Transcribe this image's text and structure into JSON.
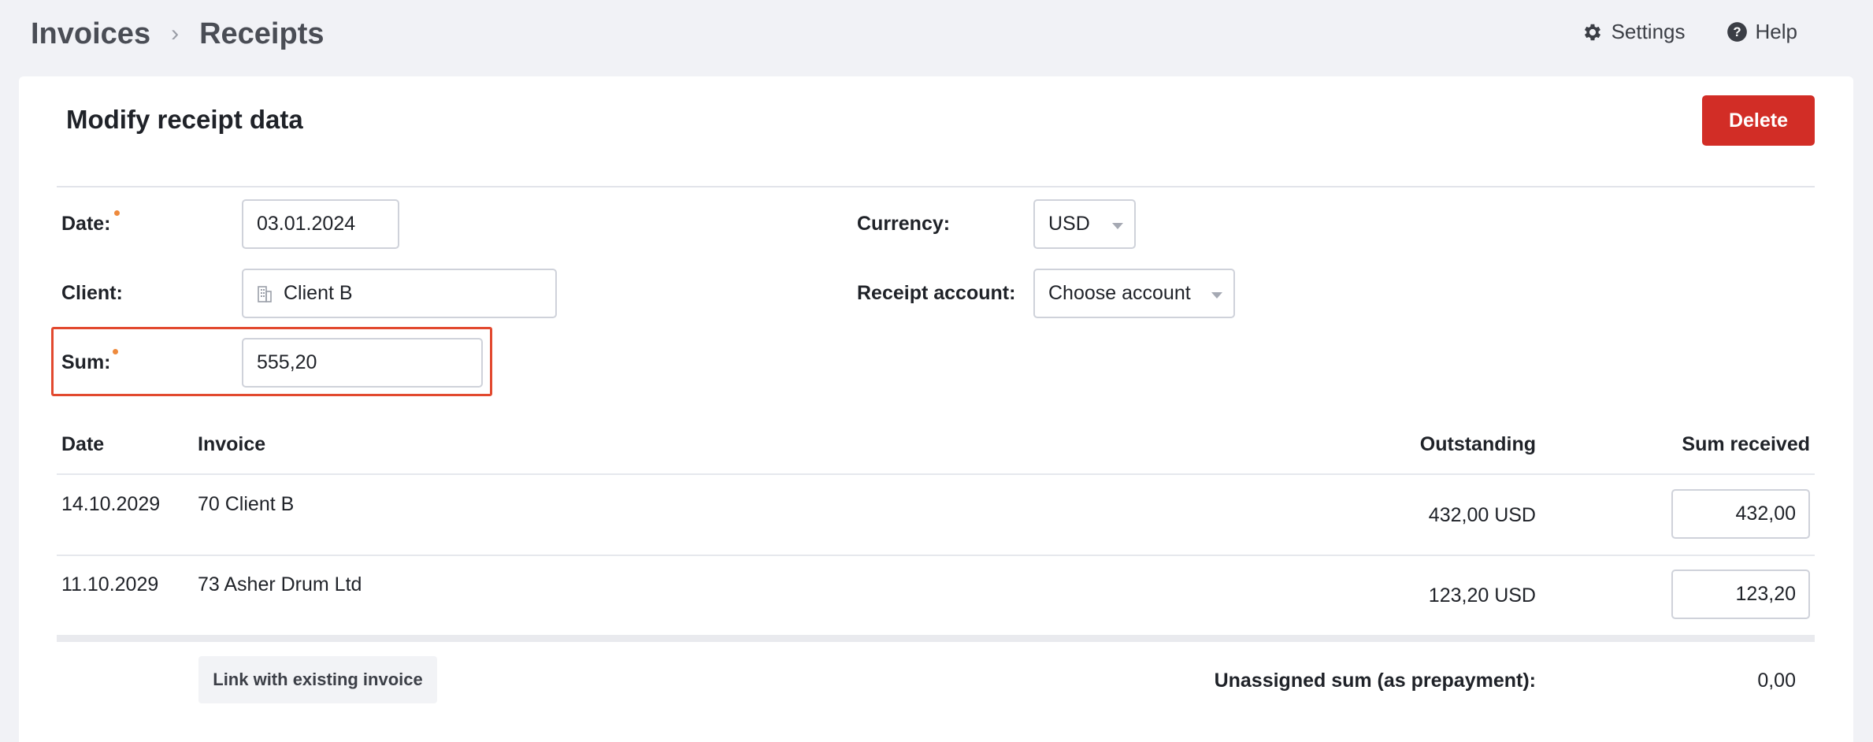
{
  "breadcrumb": {
    "parent": "Invoices",
    "separator": "›",
    "current": "Receipts"
  },
  "top_actions": {
    "settings_label": "Settings",
    "help_label": "Help"
  },
  "page": {
    "title": "Modify receipt data",
    "delete_label": "Delete"
  },
  "form": {
    "date_label": "Date:",
    "date_value": "03.01.2024",
    "client_label": "Client:",
    "client_value": "Client B",
    "sum_label": "Sum:",
    "sum_value": "555,20",
    "currency_label": "Currency:",
    "currency_value": "USD",
    "account_label": "Receipt account:",
    "account_value": "Choose account"
  },
  "table": {
    "headers": {
      "date": "Date",
      "invoice": "Invoice",
      "outstanding": "Outstanding",
      "sum_received": "Sum received"
    },
    "rows": [
      {
        "date": "14.10.2029",
        "invoice": "70 Client B",
        "outstanding": "432,00 USD",
        "sum_received": "432,00"
      },
      {
        "date": "11.10.2029",
        "invoice": "73 Asher Drum Ltd",
        "outstanding": "123,20 USD",
        "sum_received": "123,20"
      }
    ]
  },
  "footer": {
    "link_label": "Link with existing invoice",
    "unassigned_label": "Unassigned sum (as prepayment):",
    "unassigned_value": "0,00"
  },
  "colors": {
    "delete": "#d22d26",
    "highlight": "#e2492f",
    "required_dot": "#ee8a3d",
    "background": "#f1f2f6"
  }
}
